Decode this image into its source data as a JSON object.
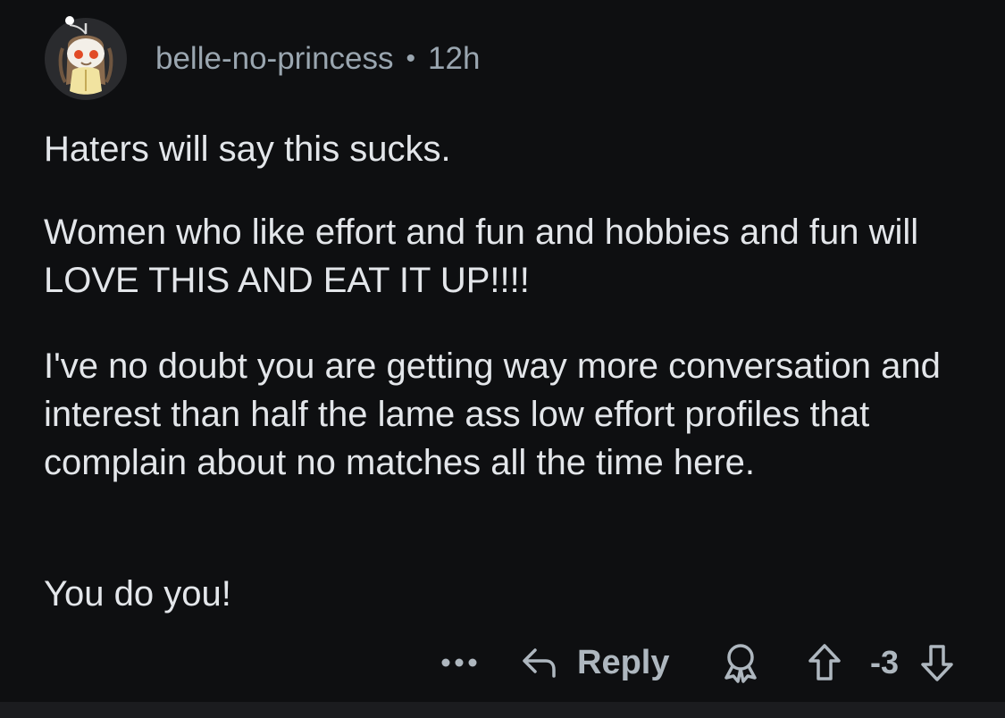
{
  "author": {
    "username": "belle-no-princess",
    "separator": "•",
    "time": "12h"
  },
  "comment": {
    "paragraphs": [
      "Haters will say this sucks.",
      "Women who like effort and fun and hobbies and fun will LOVE THIS AND EAT IT UP!!!!",
      "I've no doubt you are getting way more conversation and interest than half the lame ass low effort profiles that complain about no matches all the time here.",
      "You do you!"
    ]
  },
  "actions": {
    "more_icon": "more-icon",
    "reply_icon": "reply-icon",
    "reply_label": "Reply",
    "award_icon": "award-icon",
    "upvote_icon": "upvote-icon",
    "score": "-3",
    "downvote_icon": "downvote-icon"
  },
  "colors": {
    "background": "#0e0f11",
    "text": "#e3e6ea",
    "muted": "#9aa6b0",
    "actions": "#aeb7bf"
  }
}
